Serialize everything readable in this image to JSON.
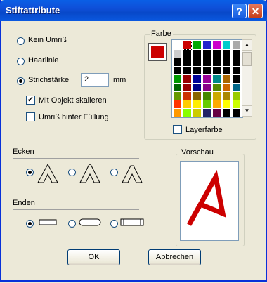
{
  "window": {
    "title": "Stiftattribute",
    "help_glyph": "?",
    "close_glyph": "✕"
  },
  "outline": {
    "none_label": "Kein Umriß",
    "hairline_label": "Haarlinie",
    "width_label": "Strichstärke",
    "width_value": "2",
    "width_unit": "mm",
    "scale_label": "Mit Objekt skalieren",
    "scale_checked": true,
    "behind_fill_label": "Umriß hinter Füllung",
    "behind_fill_checked": false
  },
  "color": {
    "group_label": "Farbe",
    "current": "#cc0000",
    "layer_color_label": "Layerfarbe",
    "palette": [
      "#ffffff",
      "#cc0000",
      "#00aa00",
      "#2222cc",
      "#cc00cc",
      "#00cccc",
      "#aaaaaa",
      "#cccccc",
      "#000000",
      "#000000",
      "#000000",
      "#000000",
      "#000000",
      "#000000",
      "#000000",
      "#000000",
      "#000000",
      "#000000",
      "#000000",
      "#000000",
      "#000000",
      "#000000",
      "#000000",
      "#000000",
      "#000000",
      "#000000",
      "#000000",
      "#000000",
      "#009900",
      "#990000",
      "#000099",
      "#990099",
      "#008888",
      "#aa6600",
      "#000000",
      "#006600",
      "#990000",
      "#000088",
      "#880088",
      "#558800",
      "#cc6600",
      "#006688",
      "#669900",
      "#cc3300",
      "#886600",
      "#448800",
      "#ccaa00",
      "#aa8800",
      "#99cc00",
      "#ff3300",
      "#ffcc00",
      "#ffee00",
      "#66cc00",
      "#ffaa00",
      "#ffff00",
      "#ccff00",
      "#ff9900",
      "#88ff00",
      "#cccc00",
      "#222266",
      "#660044",
      "#000000",
      "#000000"
    ]
  },
  "corners": {
    "label": "Ecken",
    "options": [
      "miter-corner-icon",
      "round-corner-icon",
      "bevel-corner-icon"
    ],
    "selected": 0
  },
  "ends": {
    "label": "Enden",
    "options": [
      "butt-end-icon",
      "round-end-icon",
      "square-end-icon"
    ],
    "selected": 0
  },
  "preview": {
    "label": "Vorschau",
    "stroke_color": "#cc0000"
  },
  "buttons": {
    "ok": "OK",
    "cancel": "Abbrechen"
  }
}
